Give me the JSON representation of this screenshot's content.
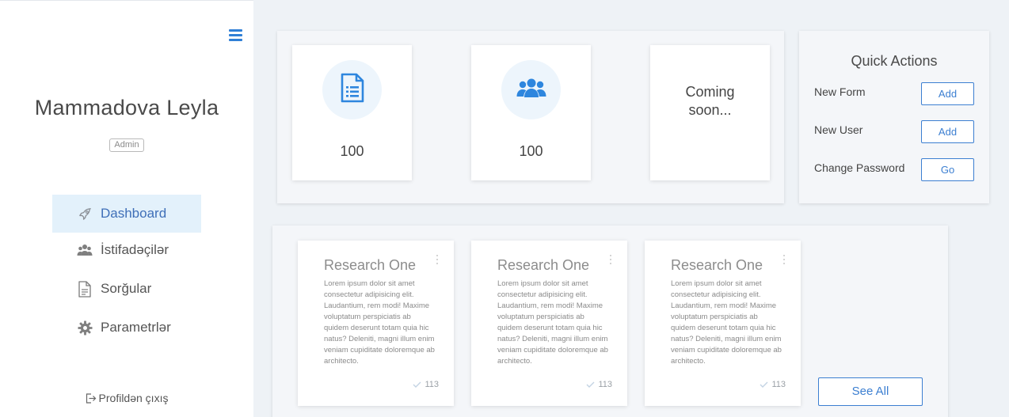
{
  "sidebar": {
    "user_name": "Mammadova Leyla",
    "role": "Admin",
    "items": [
      {
        "label": "Dashboard",
        "icon": "rocket-icon",
        "active": true
      },
      {
        "label": "İstifadəçilər",
        "icon": "users-icon",
        "active": false
      },
      {
        "label": "Sorğular",
        "icon": "document-icon",
        "active": false
      },
      {
        "label": "Parametrlər",
        "icon": "gear-icon",
        "active": false
      }
    ],
    "logout_label": "Profildən çıxış"
  },
  "stats": [
    {
      "icon": "form-document-icon",
      "value": "100"
    },
    {
      "icon": "users-group-icon",
      "value": "100"
    },
    {
      "text": "Coming soon..."
    }
  ],
  "quick_actions": {
    "title": "Quick Actions",
    "rows": [
      {
        "label": "New Form",
        "button": "Add"
      },
      {
        "label": "New User",
        "button": "Add"
      },
      {
        "label": "Change Password",
        "button": "Go"
      }
    ]
  },
  "research_cards": [
    {
      "title": "Research One",
      "text": "Lorem ipsum dolor sit amet consectetur adipisicing elit. Laudantium, rem modi! Maxime voluptatum perspiciatis ab quidem deserunt totam quia hic natus? Deleniti, magni illum enim veniam cupiditate doloremque ab architecto.",
      "count": "113"
    },
    {
      "title": "Research One",
      "text": "Lorem ipsum dolor sit amet consectetur adipisicing elit. Laudantium, rem modi! Maxime voluptatum perspiciatis ab quidem deserunt totam quia hic natus? Deleniti, magni illum enim veniam cupiditate doloremque ab architecto.",
      "count": "113"
    },
    {
      "title": "Research One",
      "text": "Lorem ipsum dolor sit amet consectetur adipisicing elit. Laudantium, rem modi! Maxime voluptatum perspiciatis ab quidem deserunt totam quia hic natus? Deleniti, magni illum enim veniam cupiditate doloremque ab architecto.",
      "count": "113"
    }
  ],
  "see_all_label": "See All",
  "colors": {
    "accent": "#3c7fd1",
    "active_nav_bg": "#e3f1fb",
    "page_bg": "#eef2f6"
  }
}
